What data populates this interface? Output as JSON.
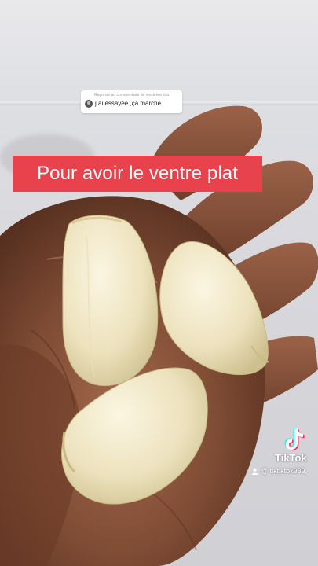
{
  "reply_bubble": {
    "header": "Reponse au commentaire de xiestelvemba",
    "comment": "j ai essayee ,ça marche"
  },
  "caption": {
    "text": "Pour avoir le ventre plat",
    "background": "#e8434d"
  },
  "watermark": {
    "brand": "TikTok",
    "handle": "@ tiktiktok939",
    "logo_icon": "tiktok-note-icon",
    "user_icon": "person-icon"
  },
  "colors": {
    "skin": "#7a4a34",
    "garlic": "#efe6c6",
    "background": "#dcdcdf"
  }
}
